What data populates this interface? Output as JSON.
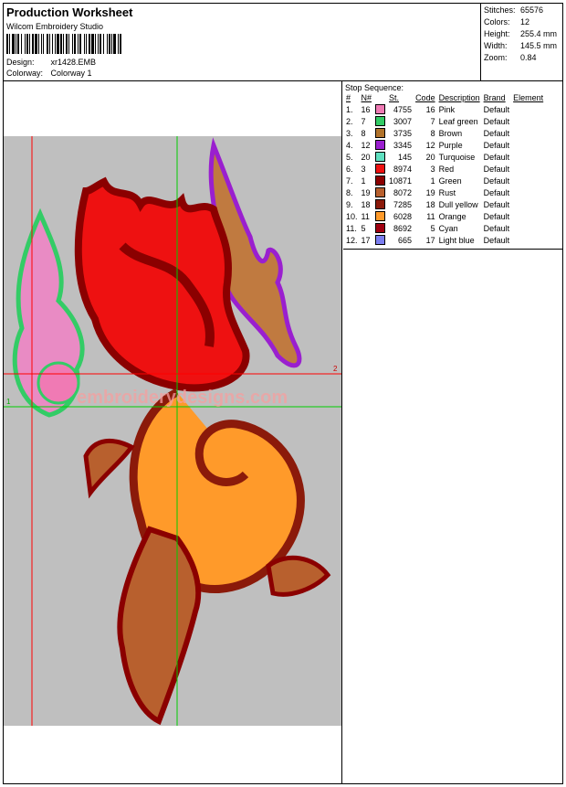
{
  "header": {
    "title": "Production Worksheet",
    "app": "Wilcom Embroidery Studio",
    "design_label": "Design:",
    "design_value": "xr1428.EMB",
    "colorway_label": "Colorway:",
    "colorway_value": "Colorway 1"
  },
  "stats": [
    {
      "label": "Stitches:",
      "value": "65576"
    },
    {
      "label": "Colors:",
      "value": "12"
    },
    {
      "label": "Height:",
      "value": "255.4 mm"
    },
    {
      "label": "Width:",
      "value": "145.5 mm"
    },
    {
      "label": "Zoom:",
      "value": "0.84"
    }
  ],
  "stop_sequence": {
    "caption": "Stop Sequence:",
    "columns": [
      "#",
      "N#",
      "St.",
      "Code",
      "Description",
      "Brand",
      "Element"
    ],
    "rows": [
      {
        "num": "1.",
        "n": "16",
        "color": "#f07ab4",
        "st": "4755",
        "code": "16",
        "desc": "Pink",
        "brand": "Default"
      },
      {
        "num": "2.",
        "n": "7",
        "color": "#33cc66",
        "st": "3007",
        "code": "7",
        "desc": "Leaf green",
        "brand": "Default"
      },
      {
        "num": "3.",
        "n": "8",
        "color": "#b0722a",
        "st": "3735",
        "code": "8",
        "desc": "Brown",
        "brand": "Default"
      },
      {
        "num": "4.",
        "n": "12",
        "color": "#9a1fcf",
        "st": "3345",
        "code": "12",
        "desc": "Purple",
        "brand": "Default"
      },
      {
        "num": "5.",
        "n": "20",
        "color": "#5fe0c0",
        "st": "145",
        "code": "20",
        "desc": "Turquoise",
        "brand": "Default"
      },
      {
        "num": "6.",
        "n": "3",
        "color": "#ee1111",
        "st": "8974",
        "code": "3",
        "desc": "Red",
        "brand": "Default"
      },
      {
        "num": "7.",
        "n": "1",
        "color": "#8b0000",
        "st": "10871",
        "code": "1",
        "desc": "Green",
        "brand": "Default"
      },
      {
        "num": "8.",
        "n": "19",
        "color": "#b8602e",
        "st": "8072",
        "code": "19",
        "desc": "Rust",
        "brand": "Default"
      },
      {
        "num": "9.",
        "n": "18",
        "color": "#8b1a0a",
        "st": "7285",
        "code": "18",
        "desc": "Dull yellow",
        "brand": "Default"
      },
      {
        "num": "10.",
        "n": "11",
        "color": "#ff9a2a",
        "st": "6028",
        "code": "11",
        "desc": "Orange",
        "brand": "Default"
      },
      {
        "num": "11.",
        "n": "5",
        "color": "#a00010",
        "st": "8692",
        "code": "5",
        "desc": "Cyan",
        "brand": "Default"
      },
      {
        "num": "12.",
        "n": "17",
        "color": "#7b7ef0",
        "st": "665",
        "code": "17",
        "desc": "Light blue",
        "brand": "Default"
      }
    ]
  },
  "artwork": {
    "guide_label_left": "1",
    "guide_label_right": "2",
    "watermark": "embroiderydesigns.com"
  }
}
